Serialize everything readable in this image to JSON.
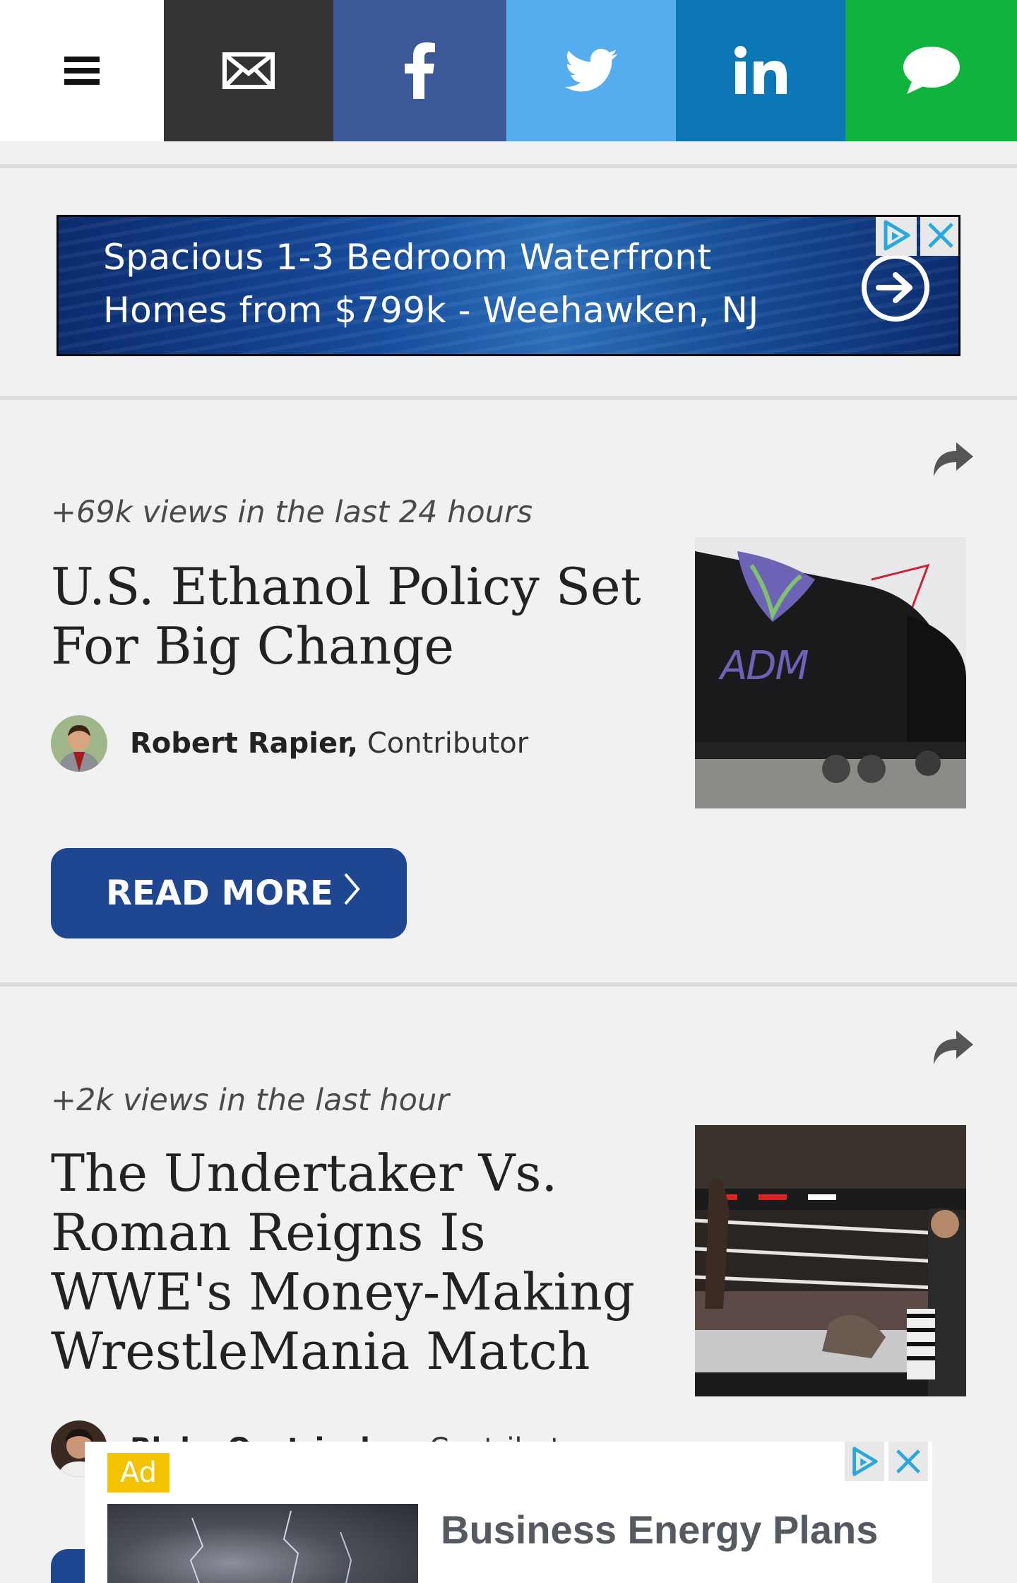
{
  "topbar": {
    "menu_icon": "hamburger-menu-icon",
    "buttons": [
      {
        "name": "email",
        "icon": "envelope-icon",
        "color": "#333333"
      },
      {
        "name": "facebook",
        "icon": "facebook-icon",
        "color": "#3b5998"
      },
      {
        "name": "twitter",
        "icon": "twitter-icon",
        "color": "#55acee"
      },
      {
        "name": "linkedin",
        "icon": "linkedin-icon",
        "color": "#0b77b5"
      },
      {
        "name": "sms",
        "icon": "speech-bubble-icon",
        "color": "#10b33c"
      }
    ]
  },
  "ad_banner": {
    "line1": "Spacious 1-3 Bedroom Waterfront",
    "line2": "Homes from $799k - Weehawken, NJ"
  },
  "articles": [
    {
      "views": "+69k views in the last 24 hours",
      "title": "U.S. Ethanol Policy Set For Big Change",
      "author": "Robert Rapier,",
      "role": "Contributor",
      "thumb_label": "ADM",
      "read_more": "READ MORE"
    },
    {
      "views": "+2k views in the last hour",
      "title": "The Undertaker Vs. Roman Reigns Is WWE's Money-Making WrestleMania Match",
      "author": "Blake Oestriecher,",
      "role": "Contributor"
    }
  ],
  "bottom_ad": {
    "badge": "Ad",
    "title": "Business Energy Plans"
  },
  "colors": {
    "accent": "#1f4791",
    "background": "#f1f1f1"
  }
}
